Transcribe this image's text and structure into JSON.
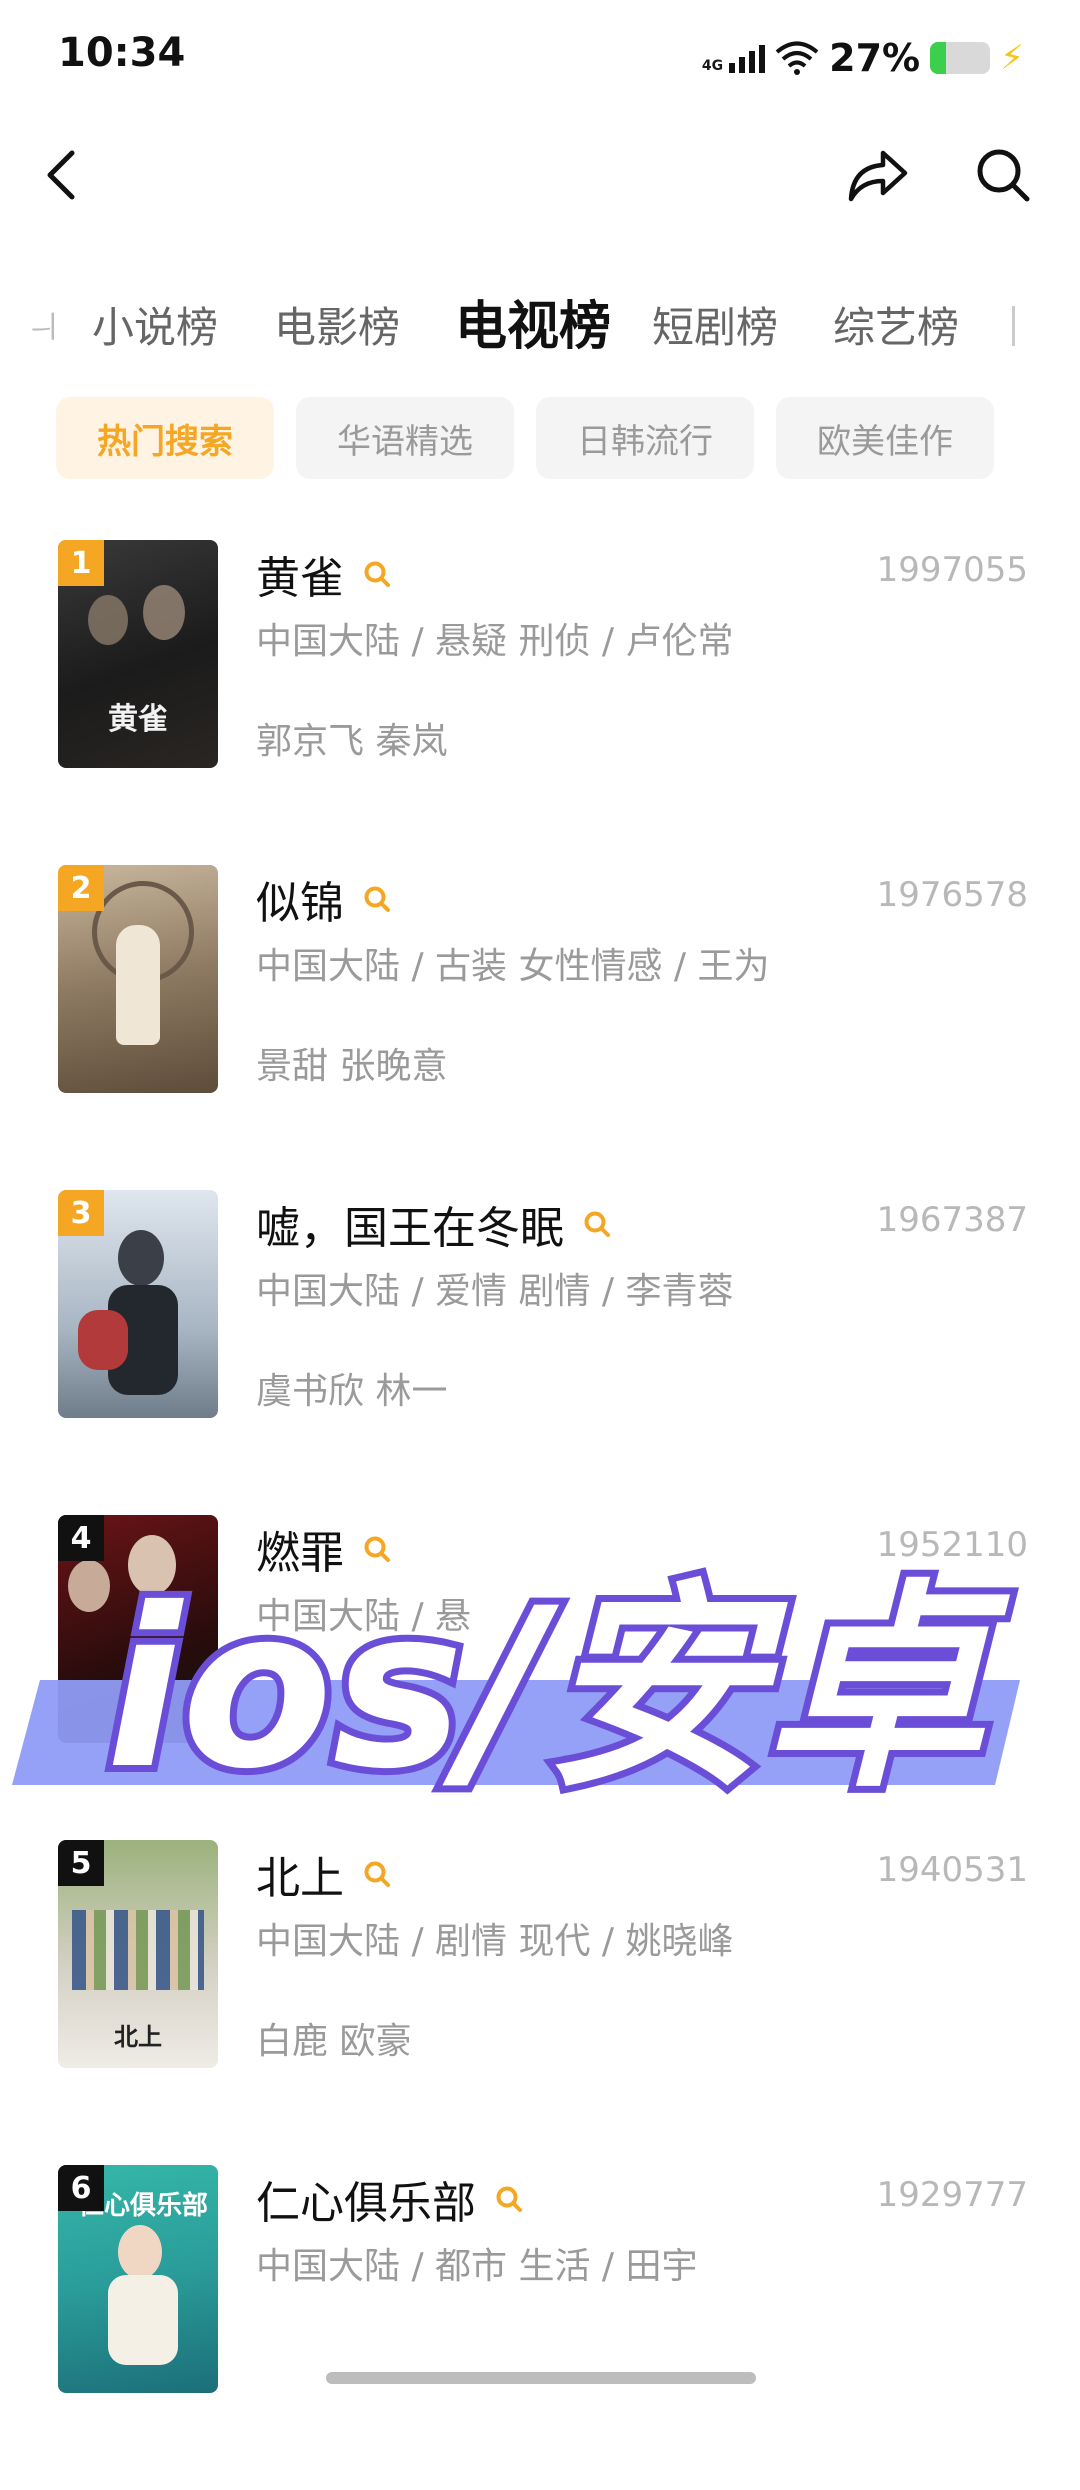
{
  "status": {
    "time": "10:34",
    "network": "4G",
    "battery": "27%",
    "battery_level": 0.27
  },
  "nav": {
    "back_icon": "chevron-left-icon",
    "share_icon": "share-icon",
    "search_icon": "search-icon"
  },
  "tabs": {
    "partial_left": "ㅢ",
    "items": [
      "小说榜",
      "电影榜",
      "电视榜",
      "短剧榜",
      "综艺榜"
    ],
    "partial_right": "",
    "active": "电视榜"
  },
  "chips": [
    {
      "label": "热门搜索",
      "active": true
    },
    {
      "label": "华语精选",
      "active": false
    },
    {
      "label": "日韩流行",
      "active": false
    },
    {
      "label": "欧美佳作",
      "active": false
    }
  ],
  "list": [
    {
      "rank": "1",
      "title": "黄雀",
      "score": "1997055",
      "meta": "中国大陆 / 悬疑 刑侦 / 卢伦常",
      "cast": "郭京飞 秦岚",
      "rank_color": "#f5a623",
      "poster_label": "黄雀"
    },
    {
      "rank": "2",
      "title": "似锦",
      "score": "1976578",
      "meta": "中国大陆 / 古装 女性情感 / 王为",
      "cast": "景甜 张晚意",
      "rank_color": "#f5a623",
      "poster_label": ""
    },
    {
      "rank": "3",
      "title": "嘘，国王在冬眠",
      "score": "1967387",
      "meta": "中国大陆 / 爱情 剧情 / 李青蓉",
      "cast": "虞书欣 林一",
      "rank_color": "#f5a623",
      "poster_label": ""
    },
    {
      "rank": "4",
      "title": "燃罪",
      "score": "1952110",
      "meta": "中国大陆 / 悬",
      "cast": "",
      "rank_color": "#111111",
      "poster_label": ""
    },
    {
      "rank": "5",
      "title": "北上",
      "score": "1940531",
      "meta": "中国大陆 / 剧情 现代 / 姚晓峰",
      "cast": "白鹿 欧豪",
      "rank_color": "#111111",
      "poster_label": "北上"
    },
    {
      "rank": "6",
      "title": "仁心俱乐部",
      "score": "1929777",
      "meta": "中国大陆 / 都市 生活 / 田宇",
      "cast": "",
      "rank_color": "#111111",
      "poster_label": "仁心俱乐部"
    }
  ],
  "overlay": {
    "text": "ios/安卓"
  },
  "colors": {
    "accent": "#f5a623",
    "chip_bg": "#f4f4f4",
    "overlay_fill": "#ffffff",
    "overlay_stroke": "#6b4ed8",
    "overlay_band": "#8f9cf5"
  }
}
